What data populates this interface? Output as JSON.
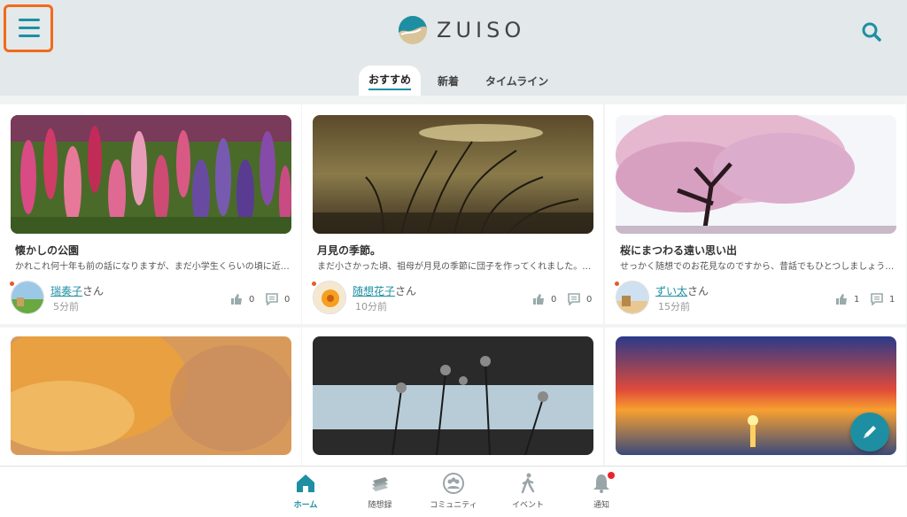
{
  "header": {
    "logo_text": "ZUISO",
    "tabs": [
      {
        "label": "おすすめ",
        "active": true
      },
      {
        "label": "新着",
        "active": false
      },
      {
        "label": "タイムライン",
        "active": false
      }
    ]
  },
  "posts": [
    {
      "title": "懐かしの公園",
      "excerpt": "かれこれ何十年も前の話になりますが、まだ小学生くらいの頃に近…",
      "author": "瑞奏子",
      "honorific": "さん",
      "time": "5分前",
      "likes": "0",
      "comments": "0"
    },
    {
      "title": "月見の季節。",
      "excerpt": "まだ小さかった頃、祖母が月見の季節に団子を作ってくれました。…",
      "author": "随想花子",
      "honorific": "さん",
      "time": "10分前",
      "likes": "0",
      "comments": "0"
    },
    {
      "title": "桜にまつわる遠い思い出",
      "excerpt": "せっかく随想でのお花見なのですから、昔話でもひとつしましょう…",
      "author": "ずい太",
      "honorific": "さん",
      "time": "15分前",
      "likes": "1",
      "comments": "1"
    }
  ],
  "bottom_nav": [
    {
      "label": "ホーム",
      "icon": "home-icon",
      "active": true
    },
    {
      "label": "随想録",
      "icon": "books-icon",
      "active": false
    },
    {
      "label": "コミュニティ",
      "icon": "community-icon",
      "active": false
    },
    {
      "label": "イベント",
      "icon": "walking-person-icon",
      "active": false
    },
    {
      "label": "通知",
      "icon": "bell-icon",
      "active": false
    }
  ],
  "colors": {
    "accent": "#1e8fa3",
    "highlight_border": "#f26a1b",
    "header_bg": "#e3e8ea",
    "notification": "#e8262a"
  }
}
